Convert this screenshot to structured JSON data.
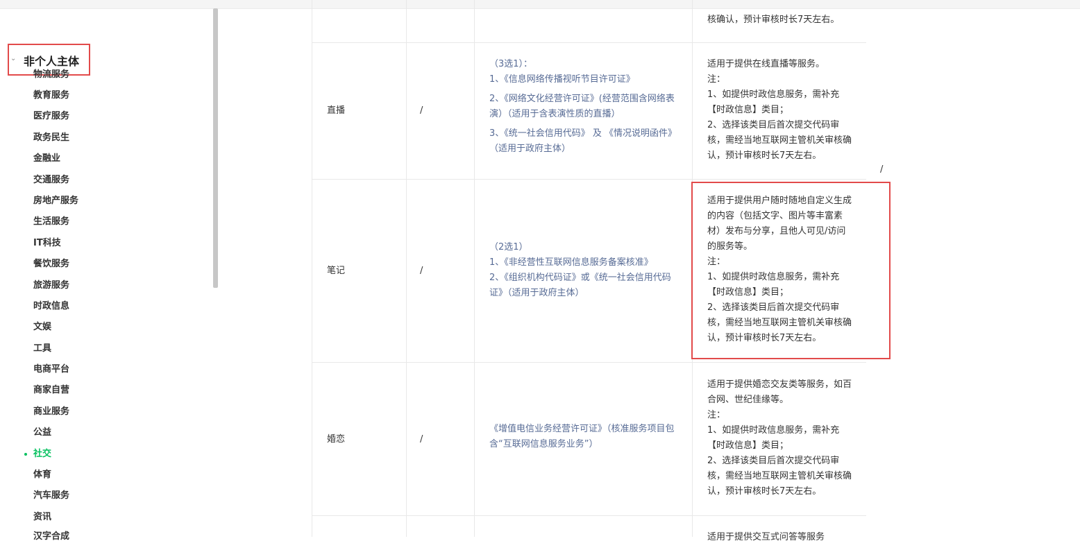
{
  "sidebar": {
    "group_title": "非个人主体",
    "items": [
      {
        "label": "物流服务"
      },
      {
        "label": "教育服务"
      },
      {
        "label": "医疗服务"
      },
      {
        "label": "政务民生"
      },
      {
        "label": "金融业"
      },
      {
        "label": "交通服务"
      },
      {
        "label": "房地产服务"
      },
      {
        "label": "生活服务"
      },
      {
        "label": "IT科技"
      },
      {
        "label": "餐饮服务"
      },
      {
        "label": "旅游服务"
      },
      {
        "label": "时政信息"
      },
      {
        "label": "文娱"
      },
      {
        "label": "工具"
      },
      {
        "label": "电商平台"
      },
      {
        "label": "商家自营"
      },
      {
        "label": "商业服务"
      },
      {
        "label": "公益"
      },
      {
        "label": "社交",
        "active": true
      },
      {
        "label": "体育"
      },
      {
        "label": "汽车服务"
      },
      {
        "label": "资讯"
      },
      {
        "label": "汉字合成"
      }
    ]
  },
  "table": {
    "top_partial_desc": "核确认，预计审核时长7天左右。",
    "stray_slash": "/",
    "rows": [
      {
        "name": "直播",
        "slash": "/",
        "requirements": [
          "（3选1）：",
          "1、《信息网络传播视听节目许可证》",
          "2、《网络文化经营许可证》(经营范围含网络表演）（适用于含表演性质的直播）",
          "3、《统一社会信用代码》 及 《情况说明函件》（适用于政府主体）"
        ],
        "description": [
          "适用于提供在线直播等服务。",
          "注：",
          "1、如提供时政信息服务，需补充【时政信息】类目；",
          "2、选择该类目后首次提交代码审核，需经当地互联网主管机关审核确认，预计审核时长7天左右。"
        ]
      },
      {
        "name": "笔记",
        "slash": "/",
        "requirements": [
          "（2选1）",
          "1、《非经营性互联网信息服务备案核准》",
          "2、《组织机构代码证》或《统一社会信用代码证》（适用于政府主体）"
        ],
        "description": [
          "适用于提供用户随时随地自定义生成的内容（包括文字、图片等丰富素材）发布与分享，且他人可见/访问的服务等。",
          "注：",
          "1、如提供时政信息服务，需补充【时政信息】类目；",
          "2、选择该类目后首次提交代码审核，需经当地互联网主管机关审核确认，预计审核时长7天左右。"
        ]
      },
      {
        "name": "婚恋",
        "slash": "/",
        "requirements": [
          "《增值电信业务经营许可证》（核准服务项目包含“互联网信息服务业务”）"
        ],
        "description": [
          "适用于提供婚恋交友类等服务，如百合网、世纪佳缘等。",
          "注：",
          "1、如提供时政信息服务，需补充【时政信息】类目；",
          "2、选择该类目后首次提交代码审核，需经当地互联网主管机关审核确认，预计审核时长7天左右。"
        ]
      }
    ],
    "bottom_partial_desc": "适用于提供交互式问答等服务"
  }
}
